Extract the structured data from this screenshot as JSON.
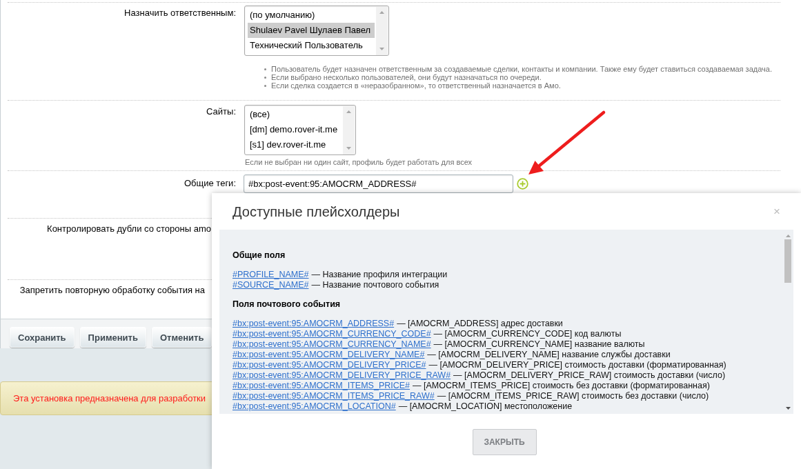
{
  "form": {
    "rows": [
      {
        "kind": "listbox",
        "label": "Назначить ответственным:",
        "options": [
          {
            "text": "(по умолчанию)",
            "selected": false
          },
          {
            "text": "Shulaev Pavel Шулаев Павел",
            "selected": true
          },
          {
            "text": "Технический Пользователь",
            "selected": false
          }
        ],
        "hints": [
          "Пользователь будет назначен ответственным за создаваемые сделки, контакты и компании. Также ему будет ставиться создаваемая задача.",
          "Если выбрано несколько пользователей, они будут назначаться по очереди.",
          "Если сделка создается в «неразобранном», то ответственный назначается в Амо."
        ]
      },
      {
        "kind": "listbox",
        "label": "Сайты:",
        "options": [
          {
            "text": "(все)",
            "selected": false
          },
          {
            "text": "[dm] demo.rover-it.me",
            "selected": false
          },
          {
            "text": "[s1] dev.rover-it.me",
            "selected": false
          }
        ],
        "note": "Если не выбран ни один сайт, профиль будет работать для всех"
      },
      {
        "kind": "text",
        "label": "Общие теги:",
        "value": "#bx:post-event:95:AMOCRM_ADDRESS#"
      },
      {
        "kind": "covered",
        "label": "Контролировать дубли со стороны amo"
      },
      {
        "kind": "covered",
        "label": "Запретить повторную обработку события на"
      }
    ],
    "buttons": [
      "Сохранить",
      "Применить",
      "Отменить"
    ]
  },
  "notice": {
    "text": "Эта установка предназначена для разработки"
  },
  "dialog": {
    "title": "Доступные плейсхолдеры",
    "close": "×",
    "sections": [
      {
        "heading": "Общие поля",
        "items": [
          {
            "code": "#PROFILE_NAME#",
            "description": "— Название профиля интеграции"
          },
          {
            "code": "#SOURCE_NAME#",
            "description": "— Название почтового события"
          }
        ]
      },
      {
        "heading": "Поля почтового события",
        "items": [
          {
            "code": "#bx:post-event:95:AMOCRM_ADDRESS#",
            "description": "— [AMOCRM_ADDRESS] адрес доставки"
          },
          {
            "code": "#bx:post-event:95:AMOCRM_CURRENCY_CODE#",
            "description": "— [AMOCRM_CURRENCY_CODE] код валюты"
          },
          {
            "code": "#bx:post-event:95:AMOCRM_CURRENCY_NAME#",
            "description": "— [AMOCRM_CURRENCY_NAME] название валюты"
          },
          {
            "code": "#bx:post-event:95:AMOCRM_DELIVERY_NAME#",
            "description": "— [AMOCRM_DELIVERY_NAME] название службы доставки"
          },
          {
            "code": "#bx:post-event:95:AMOCRM_DELIVERY_PRICE#",
            "description": "— [AMOCRM_DELIVERY_PRICE] стоимость доставки (форматированная)"
          },
          {
            "code": "#bx:post-event:95:AMOCRM_DELIVERY_PRICE_RAW#",
            "description": "— [AMOCRM_DELIVERY_PRICE_RAW] стоимость доставки (число)"
          },
          {
            "code": "#bx:post-event:95:AMOCRM_ITEMS_PRICE#",
            "description": "— [AMOCRM_ITEMS_PRICE] стоимость без доставки (форматированная)"
          },
          {
            "code": "#bx:post-event:95:AMOCRM_ITEMS_PRICE_RAW#",
            "description": "— [AMOCRM_ITEMS_PRICE_RAW] стоимость без доставки (число)"
          },
          {
            "code": "#bx:post-event:95:AMOCRM_LOCATION#",
            "description": "— [AMOCRM_LOCATION] местоположение"
          }
        ]
      }
    ],
    "buttons": [
      "ЗАКРЫТЬ"
    ]
  }
}
